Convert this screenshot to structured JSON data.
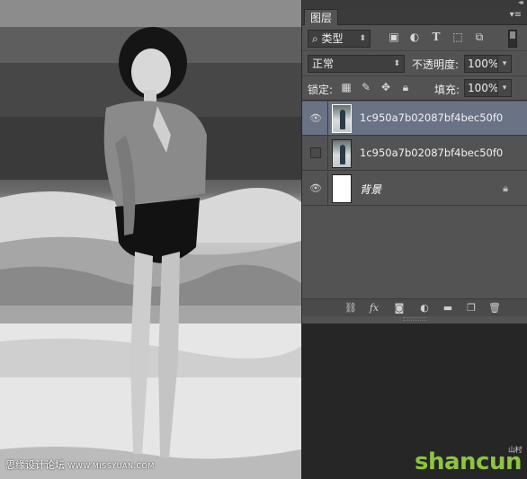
{
  "panel": {
    "tab_label": "图层",
    "filter": {
      "label": "类型",
      "icons": [
        "image-filter-icon",
        "adjustment-filter-icon",
        "type-filter-icon",
        "shape-filter-icon",
        "smartobject-filter-icon"
      ]
    },
    "blend_mode": "正常",
    "opacity_label": "不透明度:",
    "opacity_value": "100%",
    "lock_label": "锁定:",
    "fill_label": "填充:",
    "fill_value": "100%",
    "layers": [
      {
        "name": "1c950a7b02087bf4bec50f03f...",
        "visible": true,
        "selected": true
      },
      {
        "name": "1c950a7b02087bf4bec50f03f...",
        "visible": false,
        "selected": false
      },
      {
        "name": "背景",
        "visible": true,
        "selected": false,
        "locked": true
      }
    ]
  },
  "photo": {
    "caption_main": "思缘设计论坛",
    "caption_url": "WWW.MISSYUAN.COM"
  },
  "watermark": {
    "text": "shancun",
    "sub": "山村"
  },
  "colors": {
    "panel_bg": "#535353",
    "selected_layer": "#6a7286",
    "watermark_green": "#8cc63f"
  }
}
